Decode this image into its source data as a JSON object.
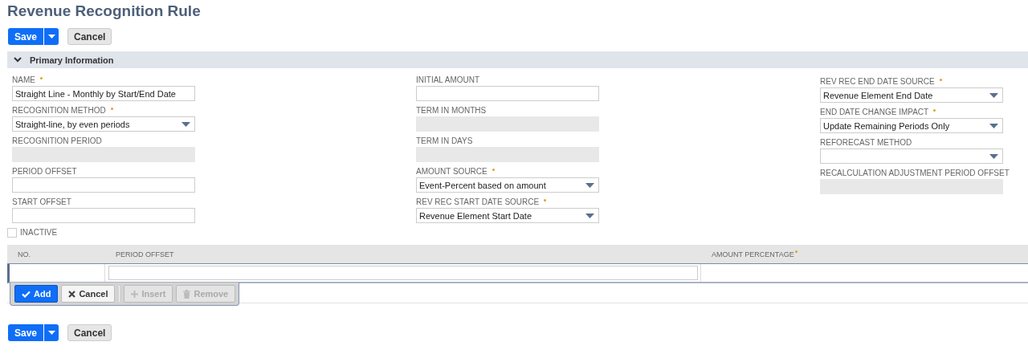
{
  "page": {
    "title": "Revenue Recognition Rule"
  },
  "top_actions": {
    "save": "Save",
    "cancel": "Cancel"
  },
  "section": {
    "title": "Primary Information",
    "expanded": true
  },
  "columns": [
    [
      {
        "label": "NAME",
        "required": true,
        "kind": "text",
        "value": "Straight Line - Monthly by Start/End Date"
      },
      {
        "label": "RECOGNITION METHOD",
        "required": true,
        "kind": "select",
        "value": "Straight-line, by even periods"
      },
      {
        "label": "RECOGNITION PERIOD",
        "required": false,
        "kind": "readonly"
      },
      {
        "label": "PERIOD OFFSET",
        "required": false,
        "kind": "text"
      },
      {
        "label": "START OFFSET",
        "required": false,
        "kind": "text"
      }
    ],
    [
      {
        "label": "INITIAL AMOUNT",
        "required": false,
        "kind": "text"
      },
      {
        "label": "TERM IN MONTHS",
        "required": false,
        "kind": "readonly"
      },
      {
        "label": "TERM IN DAYS",
        "required": false,
        "kind": "readonly"
      },
      {
        "label": "AMOUNT SOURCE",
        "required": true,
        "kind": "select",
        "value": "Event-Percent based on amount"
      },
      {
        "label": "REV REC START DATE SOURCE",
        "required": true,
        "kind": "select",
        "value": "Revenue Element Start Date"
      }
    ],
    [
      {
        "label": "REV REC END DATE SOURCE",
        "required": true,
        "kind": "select",
        "value": "Revenue Element End Date"
      },
      {
        "label": "END DATE CHANGE IMPACT",
        "required": true,
        "kind": "select",
        "value": "Update Remaining Periods Only"
      },
      {
        "label": "REFORECAST METHOD",
        "required": false,
        "kind": "select"
      },
      {
        "label": "RECALCULATION ADJUSTMENT PERIOD OFFSET",
        "required": false,
        "kind": "readonly"
      }
    ]
  ],
  "inactive": {
    "label": "INACTIVE",
    "checked": false
  },
  "sublist": {
    "columns": [
      {
        "label": "NO.",
        "required": false
      },
      {
        "label": "PERIOD OFFSET",
        "required": false
      },
      {
        "label": "AMOUNT PERCENTAGE",
        "required": true
      }
    ],
    "buttons": [
      {
        "label": "Add",
        "kind": "add",
        "disabled": false
      },
      {
        "label": "Cancel",
        "kind": "cancel",
        "disabled": false
      },
      {
        "label": "Insert",
        "kind": "insert",
        "disabled": true
      },
      {
        "label": "Remove",
        "kind": "remove",
        "disabled": true
      }
    ]
  },
  "bottom_actions": {
    "save": "Save",
    "cancel": "Cancel"
  }
}
